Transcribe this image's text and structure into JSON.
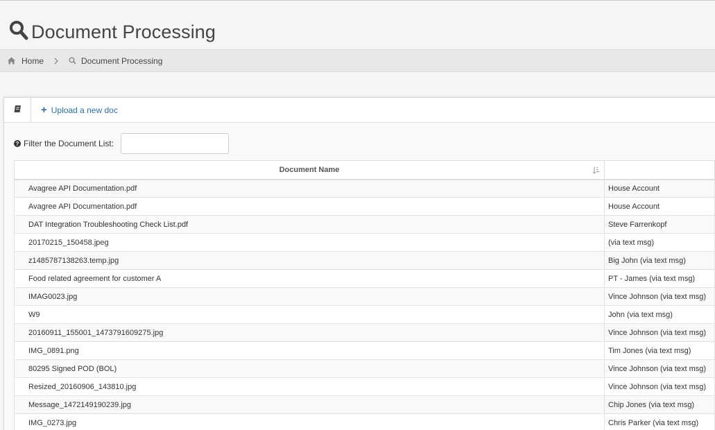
{
  "page": {
    "title": "Document Processing"
  },
  "breadcrumb": {
    "home": "Home",
    "current": "Document Processing"
  },
  "toolbar": {
    "upload_label": "Upload a new doc"
  },
  "filter": {
    "label": "Filter the Document List:",
    "value": "",
    "placeholder": ""
  },
  "table": {
    "columns": [
      "Document Name",
      ""
    ],
    "rows": [
      [
        "Avagree API Documentation.pdf",
        "House Account"
      ],
      [
        "Avagree API Documentation.pdf",
        "House Account"
      ],
      [
        "DAT Integration Troubleshooting Check List.pdf",
        "Steve Farrenkopf"
      ],
      [
        "20170215_150458.jpeg",
        "(via text msg)"
      ],
      [
        "z1485787138263.temp.jpg",
        "Big John (via text msg)"
      ],
      [
        "Food related agreement for customer A",
        "PT - James (via text msg)"
      ],
      [
        "IMAG0023.jpg",
        "Vince Johnson (via text msg)"
      ],
      [
        "W9",
        "John (via text msg)"
      ],
      [
        "20160911_155001_1473791609275.jpg",
        "Vince Johnson (via text msg)"
      ],
      [
        "IMG_0891.png",
        "Tim Jones (via text msg)"
      ],
      [
        "80295 Signed POD (BOL)",
        "Vince Johnson (via text msg)"
      ],
      [
        "Resized_20160906_143810.jpg",
        "Vince Johnson (via text msg)"
      ],
      [
        "Message_1472149190239.jpg",
        "Chip Jones (via text msg)"
      ],
      [
        "IMG_0273.jpg",
        "Chris Parker (via text msg)"
      ]
    ]
  },
  "icons": {
    "title": "search-icon",
    "home": "home-icon",
    "separator": "chevron-right-icon",
    "current": "search-icon",
    "toolbar": "book-icon",
    "upload": "plus-icon",
    "filter": "question-circle-icon",
    "sort": "sort-amount-icon"
  },
  "colors": {
    "link": "#2a6eb0",
    "title": "#444444",
    "breadcrumb_bg": "#e8e8e8"
  }
}
